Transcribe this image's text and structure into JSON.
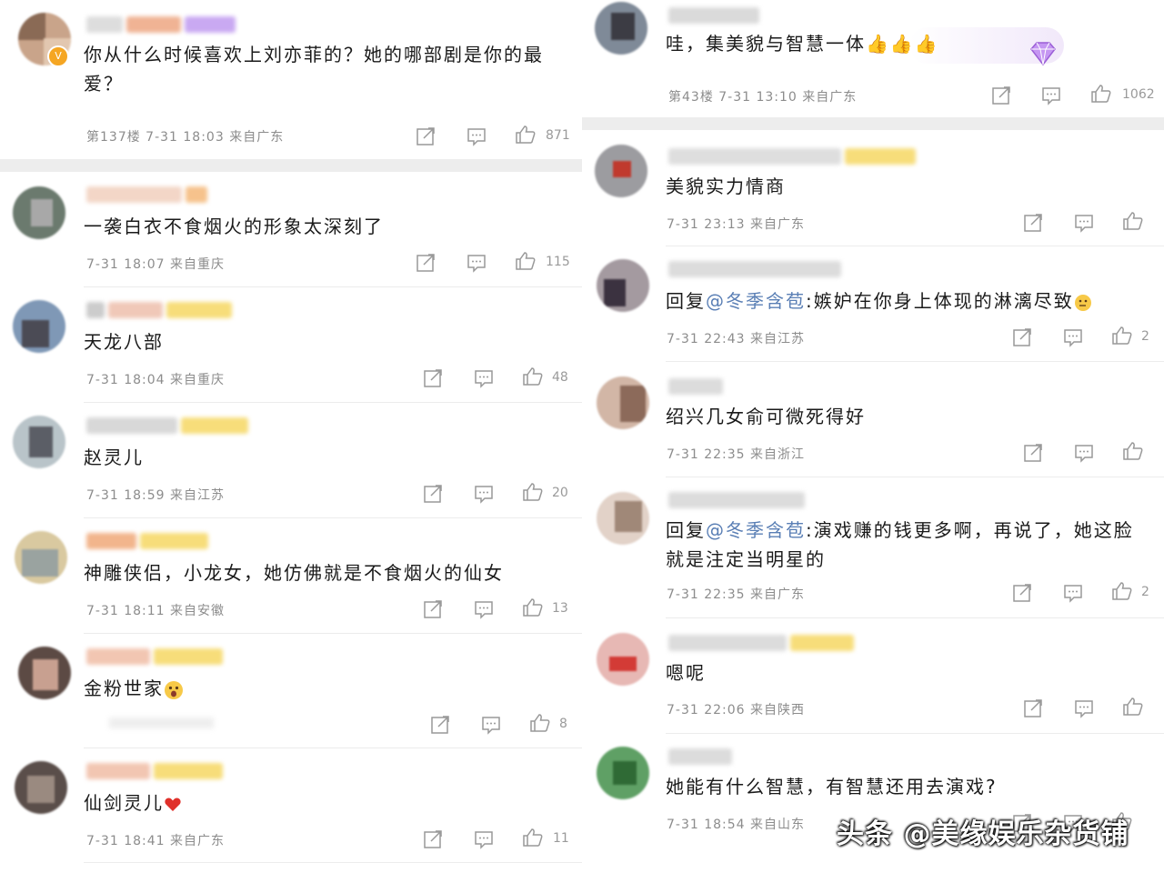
{
  "left": [
    {
      "text": "你从什么时候喜欢上刘亦菲的？她的哪部剧是你的最爱？",
      "meta": "第137楼 7-31 18:03 来自广东",
      "likes": "871"
    },
    {
      "text": "一袭白衣不食烟火的形象太深刻了",
      "meta": "7-31 18:07 来自重庆",
      "likes": "115"
    },
    {
      "text": "天龙八部",
      "meta": "7-31 18:04 来自重庆",
      "likes": "48"
    },
    {
      "text": "赵灵儿",
      "meta": "7-31 18:59 来自江苏",
      "likes": "20"
    },
    {
      "text": "神雕侠侣，小龙女，她仿佛就是不食烟火的仙女",
      "meta": "7-31 18:11 来自安徽",
      "likes": "13"
    },
    {
      "text": "金粉世家",
      "meta": "",
      "likes": "8"
    },
    {
      "text": "仙剑灵儿",
      "meta": "7-31 18:41 来自广东",
      "likes": "11"
    }
  ],
  "right": [
    {
      "text": "哇，集美貌与智慧一体",
      "meta": "第43楼 7-31 13:10 来自广东",
      "likes": "1062"
    },
    {
      "text": "美貌实力情商",
      "meta": "7-31 23:13 来自广东",
      "likes": ""
    },
    {
      "reply_prefix": "回复",
      "mention": "@冬季含苞",
      "text": ":嫉妒在你身上体现的淋漓尽致",
      "meta": "7-31 22:43 来自江苏",
      "likes": "2"
    },
    {
      "text": "绍兴几女俞可微死得好",
      "meta": "7-31 22:35 来自浙江",
      "likes": ""
    },
    {
      "reply_prefix": "回复",
      "mention": "@冬季含苞",
      "text": ":演戏赚的钱更多啊，再说了，她这脸就是注定当明星的",
      "meta": "7-31 22:35 来自广东",
      "likes": "2"
    },
    {
      "text": "嗯呢",
      "meta": "7-31 22:06 来自陕西",
      "likes": ""
    },
    {
      "text": "她能有什么智慧，有智慧还用去演戏?",
      "meta": "7-31 18:54 来自山东",
      "likes": ""
    }
  ],
  "watermark": "头条 @美缘娱乐杂货铺",
  "colors": {
    "accent": "#5a7fb5",
    "meta": "#8c8c8c",
    "divider": "#ececec"
  }
}
